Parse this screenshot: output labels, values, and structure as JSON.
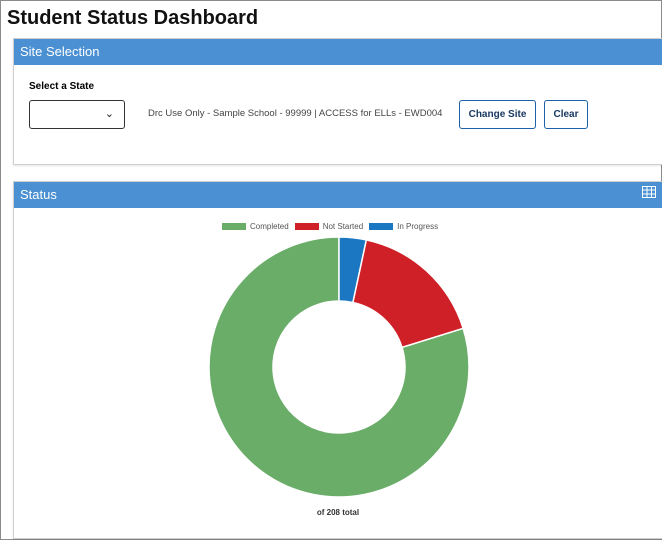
{
  "page": {
    "title": "Student Status Dashboard"
  },
  "site_selection": {
    "header": "Site Selection",
    "state_label": "Select a State",
    "state_value": "",
    "site_text": "Drc Use Only - Sample School - 99999 | ACCESS for ELLs - EWD004",
    "change_site_label": "Change Site",
    "clear_label": "Clear"
  },
  "status": {
    "header": "Status",
    "total_label": "of 208 total"
  },
  "colors": {
    "header_blue": "#4a90d2",
    "completed": "#69ad68",
    "not_started": "#cf2027",
    "in_progress": "#1c77c3"
  },
  "chart_data": {
    "type": "pie",
    "variant": "donut",
    "legend_position": "top",
    "categories": [
      "Completed",
      "Not Started",
      "In Progress"
    ],
    "values": [
      166,
      35,
      7
    ],
    "total": 208
  }
}
